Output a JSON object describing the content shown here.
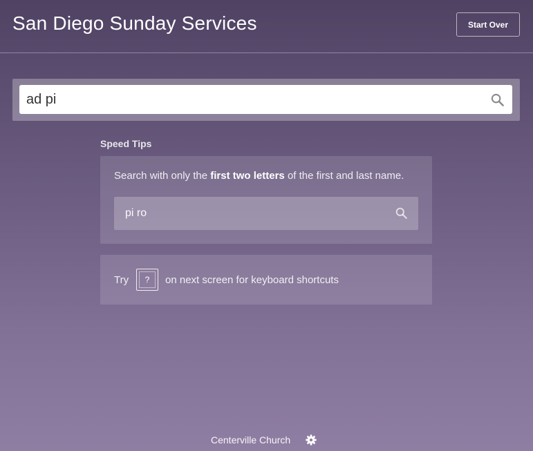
{
  "header": {
    "title": "San Diego Sunday Services",
    "start_over_label": "Start Over"
  },
  "search": {
    "value": "ad pi",
    "icon": "search-icon"
  },
  "speed_tips": {
    "heading": "Speed Tips",
    "tip1": {
      "prefix": "Search with only the ",
      "bold": "first two letters",
      "suffix": " of the first and last name."
    },
    "example": {
      "text": "pi ro",
      "icon": "search-icon"
    },
    "tip2": {
      "try_label": "Try",
      "key": "?",
      "suffix": "on next screen for keyboard shortcuts"
    }
  },
  "footer": {
    "church": "Centerville Church",
    "icon": "gear-icon"
  }
}
